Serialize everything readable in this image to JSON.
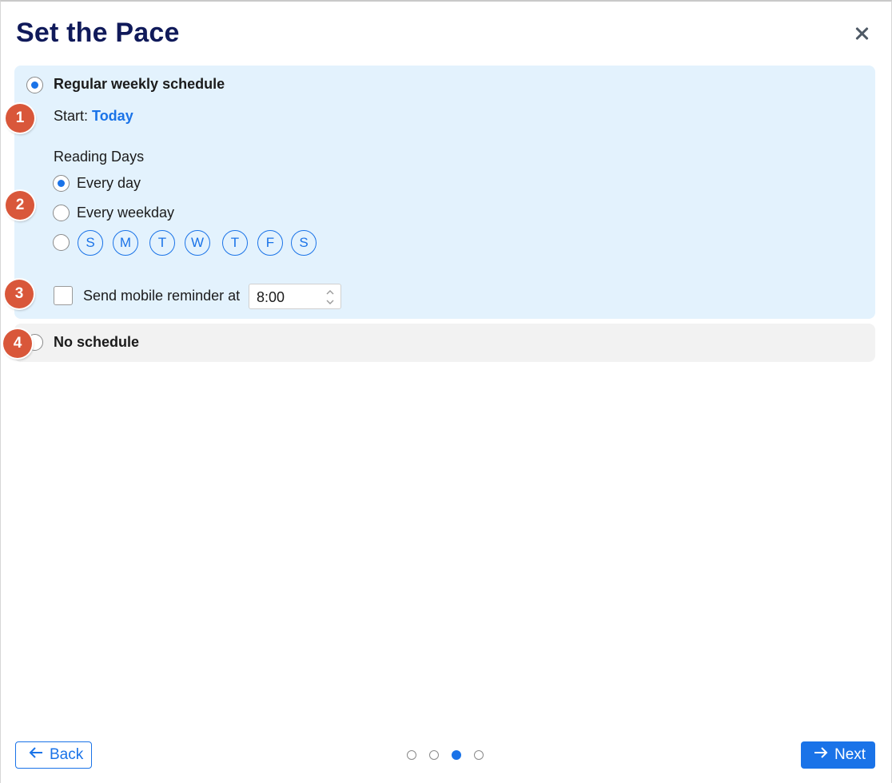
{
  "dialog": {
    "title": "Set the Pace",
    "close_icon": "close-icon"
  },
  "schedule": {
    "regular_label": "Regular weekly schedule",
    "regular_selected": true,
    "start_label": "Start:",
    "start_value": "Today",
    "reading_days_label": "Reading Days",
    "reading_options": [
      {
        "label": "Every day",
        "selected": true
      },
      {
        "label": "Every weekday",
        "selected": false
      }
    ],
    "custom_days": [
      "S",
      "M",
      "T",
      "W",
      "T",
      "F",
      "S"
    ],
    "reminder_label": "Send mobile reminder at",
    "reminder_checked": false,
    "reminder_time": "8:00",
    "no_schedule_label": "No schedule"
  },
  "markers": [
    "1",
    "2",
    "3",
    "4"
  ],
  "footer": {
    "back_label": "Back",
    "next_label": "Next",
    "pagination_total": 4,
    "pagination_current": 3
  },
  "colors": {
    "accent": "#1a73e8",
    "title": "#101a5a",
    "panel_selected": "#e3f2fd",
    "panel_unselected": "#f2f2f2",
    "marker": "#d9573a"
  }
}
